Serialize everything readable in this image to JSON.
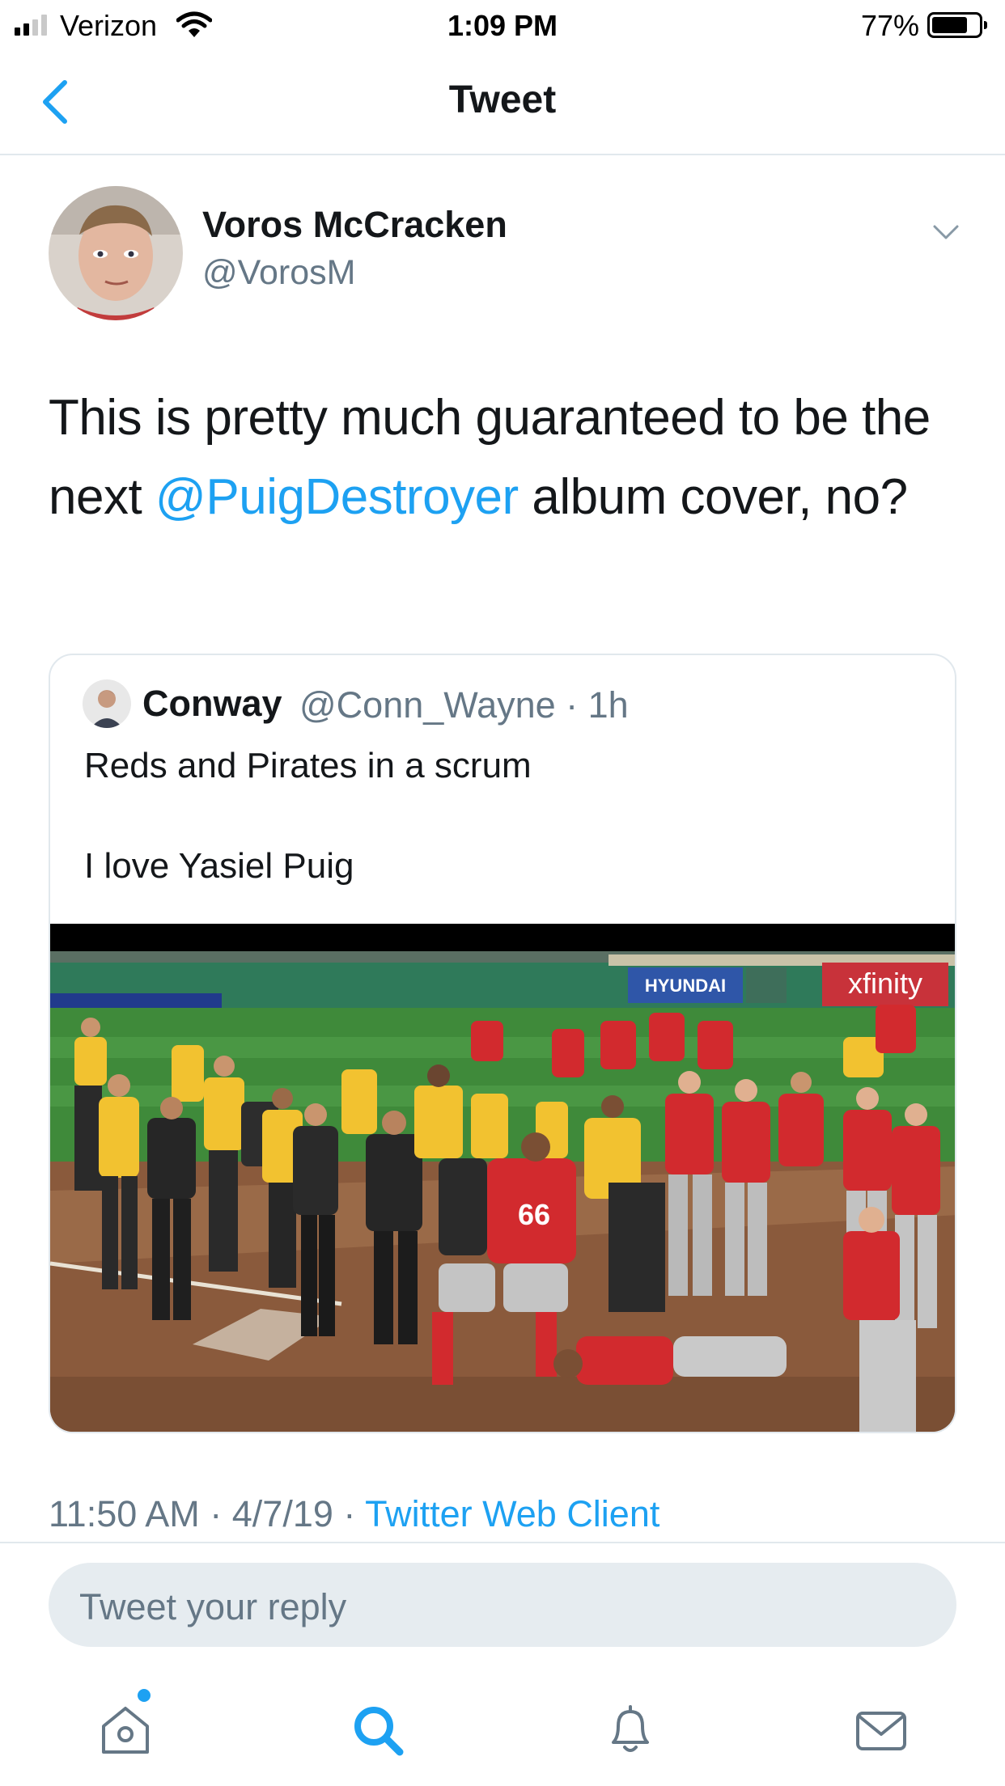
{
  "status_bar": {
    "carrier": "Verizon",
    "time": "1:09 PM",
    "battery_percent": "77%",
    "battery_level": 0.77,
    "signal_bars": 2
  },
  "nav": {
    "title": "Tweet",
    "back_icon": "chevron-left-icon"
  },
  "tweet": {
    "display_name": "Voros McCracken",
    "handle": "@VorosM",
    "text_before": "This is pretty much guaranteed to be the next ",
    "mention": "@PuigDestroyer",
    "text_after": " album cover, no?",
    "timestamp": "11:50 AM · 4/7/19 · ",
    "client": "Twitter Web Client"
  },
  "quoted_tweet": {
    "display_name": "Conway",
    "handle_time": "@Conn_Wayne · 1h",
    "line1": "Reds and Pirates in a scrum",
    "line2": "I love Yasiel Puig",
    "media": {
      "ad_hyundai": "HYUNDAI",
      "ad_xfinity": "xfinity",
      "jersey_number": "66"
    }
  },
  "reply": {
    "placeholder": "Tweet your reply"
  },
  "tabbar": {
    "items": [
      "home-icon",
      "search-icon",
      "notifications-icon",
      "messages-icon"
    ],
    "active": "search-icon"
  },
  "colors": {
    "accent": "#1da1f2",
    "text_primary": "#14171a",
    "text_secondary": "#657786",
    "border": "#e1e8ed",
    "reds": "#d22a2e",
    "pirates_gold": "#f2c230"
  }
}
